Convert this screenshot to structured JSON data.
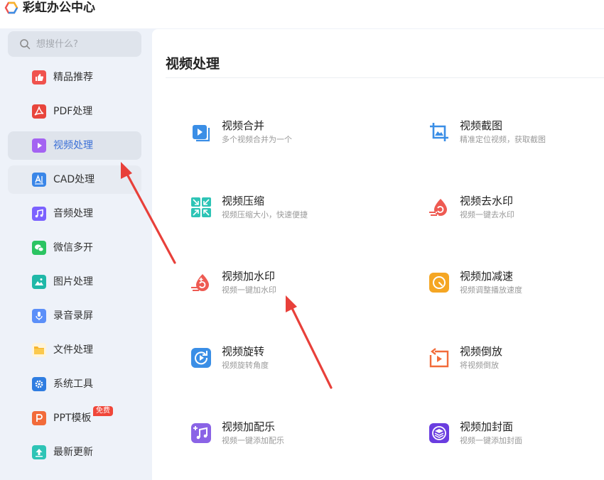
{
  "app": {
    "title": "彩虹办公中心"
  },
  "search": {
    "placeholder": "想搜什么?"
  },
  "sidebar": {
    "items": [
      {
        "label": "精品推荐",
        "icon": "thumbs-up-icon",
        "color": "#f0524d"
      },
      {
        "label": "PDF处理",
        "icon": "pdf-icon",
        "color": "#e8453c"
      },
      {
        "label": "视频处理",
        "icon": "play-icon",
        "color": "#a463f2",
        "active": true
      },
      {
        "label": "CAD处理",
        "icon": "cad-icon",
        "color": "#3a86e8"
      },
      {
        "label": "音频处理",
        "icon": "music-icon",
        "color": "#7b61ff"
      },
      {
        "label": "微信多开",
        "icon": "wechat-icon",
        "color": "#2bc462"
      },
      {
        "label": "图片处理",
        "icon": "image-icon",
        "color": "#1fb8a8"
      },
      {
        "label": "录音录屏",
        "icon": "microphone-icon",
        "color": "#5b8ff9"
      },
      {
        "label": "文件处理",
        "icon": "folder-icon",
        "color": "#f7b52c"
      },
      {
        "label": "系统工具",
        "icon": "gear-icon",
        "color": "#2f7de1"
      },
      {
        "label": "PPT模板",
        "icon": "ppt-icon",
        "color": "#f26b3a",
        "badge": "免费"
      },
      {
        "label": "最新更新",
        "icon": "upload-icon",
        "color": "#2ec4b6"
      }
    ]
  },
  "main": {
    "title": "视频处理",
    "tools": [
      {
        "name": "视频合并",
        "desc": "多个视频合并为一个",
        "icon": "video-merge-icon",
        "color": "#3a8ee6"
      },
      {
        "name": "视频截图",
        "desc": "精准定位视频，获取截图",
        "icon": "crop-screenshot-icon",
        "color": "#3a8ee6"
      },
      {
        "name": "视频压缩",
        "desc": "视频压缩大小，快速便捷",
        "icon": "compress-icon",
        "color": "#2ec4b6"
      },
      {
        "name": "视频去水印",
        "desc": "视频一键去水印",
        "icon": "remove-watermark-icon",
        "color": "#ee5a52"
      },
      {
        "name": "视频加水印",
        "desc": "视频一键加水印",
        "icon": "add-watermark-icon",
        "color": "#ee5a52"
      },
      {
        "name": "视频加减速",
        "desc": "视频调整播放速度",
        "icon": "speed-icon",
        "color": "#f5a623"
      },
      {
        "name": "视频旋转",
        "desc": "视频旋转角度",
        "icon": "rotate-icon",
        "color": "#3a8ee6"
      },
      {
        "name": "视频倒放",
        "desc": "将视频倒放",
        "icon": "reverse-icon",
        "color": "#f26b3a"
      },
      {
        "name": "视频加配乐",
        "desc": "视频一键添加配乐",
        "icon": "add-music-icon",
        "color": "#8a63e6"
      },
      {
        "name": "视频加封面",
        "desc": "视频一键添加封面",
        "icon": "add-cover-icon",
        "color": "#6a3de0"
      }
    ]
  },
  "annotations": {
    "arrow_color": "#e8403a"
  }
}
